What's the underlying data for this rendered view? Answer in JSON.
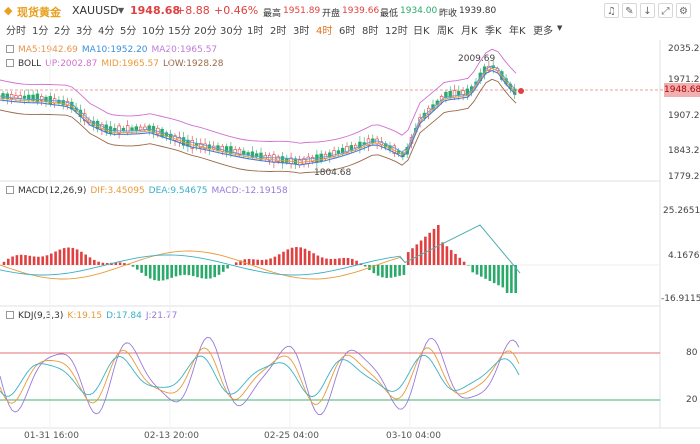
{
  "header": {
    "name": "现货黄金",
    "symbol": "XAUUSD",
    "price": "1948.68",
    "change": "+8.88",
    "change_pct": "+0.46%",
    "high_label": "最高",
    "high": "1951.89",
    "open_label": "开盘",
    "open": "1939.66",
    "low_label": "最低",
    "low": "1934.00",
    "prev_label": "昨收",
    "prev": "1939.80"
  },
  "toolbar_icons": [
    "bell-icon",
    "brush-icon",
    "download-icon",
    "expand-icon",
    "settings-icon"
  ],
  "timeframes": [
    "分时",
    "1分",
    "2分",
    "3分",
    "4分",
    "5分",
    "10分",
    "15分",
    "20分",
    "30分",
    "1时",
    "2时",
    "3时",
    "4时",
    "6时",
    "8时",
    "12时",
    "日K",
    "周K",
    "月K",
    "季K",
    "年K",
    "更多"
  ],
  "active_timeframe": "4时",
  "price_panel": {
    "ma": {
      "ma5": "MA5:1942.69",
      "ma10": "MA10:1952.20",
      "ma20": "MA20:1965.57"
    },
    "boll": {
      "title": "BOLL",
      "up": "UP:2002.87",
      "mid": "MID:1965.57",
      "low": "LOW:1928.28"
    },
    "axis": [
      "2035.29",
      "1971.29",
      "1907.28",
      "1843.28",
      "1779.28"
    ],
    "current_tag": "1948.68",
    "annotations": {
      "high": "2009.69",
      "low": "1804.68"
    },
    "colors": {
      "ma5": "#e8964a",
      "ma10": "#3a8fe0",
      "ma20": "#c07ad8",
      "up": "#d070d0",
      "mid": "#e89a3a",
      "low": "#9a6a4a",
      "ma_line": "#4a7ad8",
      "bull": "#e04040",
      "bear": "#2aaa6a"
    }
  },
  "macd_panel": {
    "title": "MACD(12,26,9)",
    "dif": "DIF:3.45095",
    "dea": "DEA:9.54675",
    "macd": "MACD:-12.19158",
    "axis": [
      "25.26514",
      "4.16768",
      "-16.91154"
    ],
    "colors": {
      "dif": "#e89a3a",
      "dea": "#3ab0c8",
      "macd": "#9a7ad8"
    }
  },
  "kdj_panel": {
    "title": "KDJ(9,3,3)",
    "k": "K:19.15",
    "d": "D:17.84",
    "j": "J:21.77",
    "axis": [
      "80",
      "20"
    ],
    "colors": {
      "k": "#e89a3a",
      "d": "#3ab0c8",
      "j": "#9a7ad8"
    }
  },
  "x_axis": [
    "01-31 16:00",
    "02-13 20:00",
    "02-25 04:00",
    "03-10 04:00"
  ]
}
